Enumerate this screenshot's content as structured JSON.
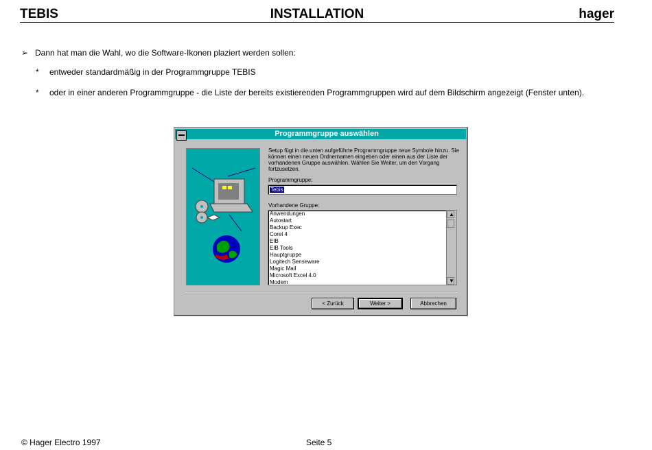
{
  "header": {
    "left": "TEBIS",
    "center": "INSTALLATION",
    "right": "hager"
  },
  "intro": {
    "bullet": "➢",
    "text": "Dann hat man die Wahl, wo die Software-Ikonen plaziert werden sollen:"
  },
  "options": [
    {
      "mark": "*",
      "text": "entweder standardmäßig in der Programmgruppe TEBIS"
    },
    {
      "mark": "*",
      "text": "oder in einer anderen Programmgruppe - die Liste der bereits existierenden Programmgruppen wird auf dem Bildschirm angezeigt (Fenster unten)."
    }
  ],
  "dialog": {
    "title": "Programmgruppe auswählen",
    "info": "Setup fügt in die unten aufgeführte Programmgruppe neue Symbole hinzu. Sie können einen neuen Ordnernamen eingeben oder einen aus der Liste der vorhandenen Gruppe auswählen. Wählen Sie Weiter, um den Vorgang fortzusetzen.",
    "program_group_label": "Programmgruppe:",
    "program_group_value": "Tebis",
    "existing_label": "Vorhandene Gruppe:",
    "groups": [
      "Anwendungen",
      "Autostart",
      "Backup Exec",
      "Corel 4",
      "EIB",
      "EIB Tools",
      "Hauptgruppe",
      "Logitech Senseware",
      "Magic Mail",
      "Microsoft Excel 4.0",
      "Modem"
    ],
    "scroll_up": "▲",
    "scroll_down": "▼",
    "back_button": "< Zurück",
    "next_button": "Weiter >",
    "cancel_button": "Abbrechen"
  },
  "footer": {
    "left": "© Hager Electro 1997",
    "center": "Seite 5"
  }
}
